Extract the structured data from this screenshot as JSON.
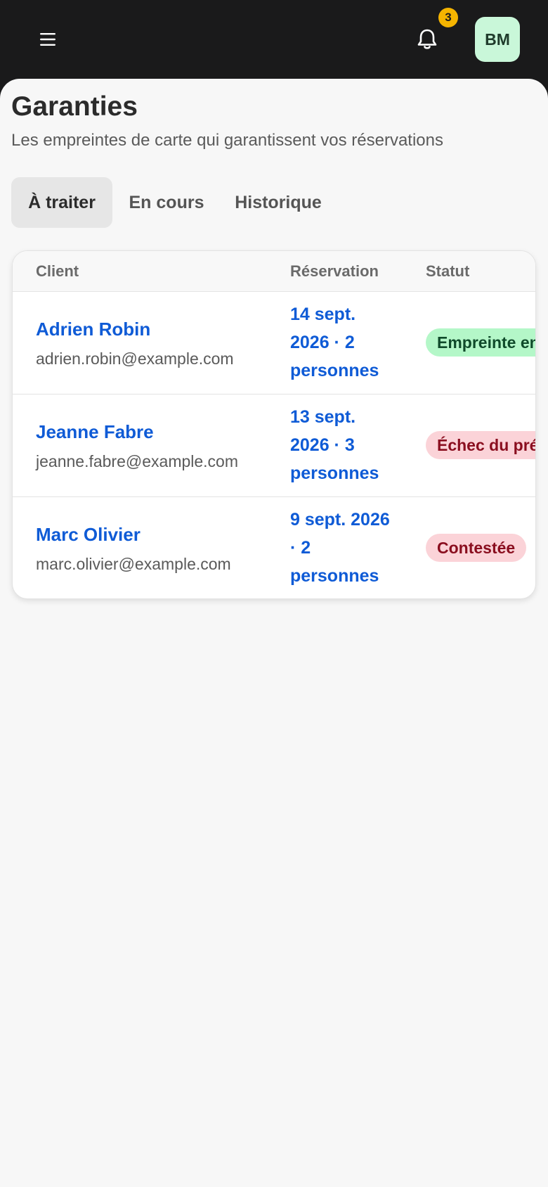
{
  "header": {
    "notifications_count": "3",
    "avatar_initials": "BM"
  },
  "page": {
    "title": "Garanties",
    "subtitle": "Les empreintes de carte qui garantissent vos réservations"
  },
  "tabs": [
    {
      "label": "À traiter",
      "active": true
    },
    {
      "label": "En cours",
      "active": false
    },
    {
      "label": "Historique",
      "active": false
    }
  ],
  "table": {
    "columns": [
      "Client",
      "Réservation",
      "Statut"
    ],
    "rows": [
      {
        "name": "Adrien Robin",
        "email": "adrien.robin@example.com",
        "reservation": "14 sept. 2026 · 2 personnes",
        "status": "Empreinte en",
        "status_tone": "green"
      },
      {
        "name": "Jeanne Fabre",
        "email": "jeanne.fabre@example.com",
        "reservation": "13 sept. 2026 · 3 personnes",
        "status": "Échec du prél",
        "status_tone": "red"
      },
      {
        "name": "Marc Olivier",
        "email": "marc.olivier@example.com",
        "reservation": "9 sept. 2026 · 2 personnes",
        "status": "Contestée",
        "status_tone": "red"
      }
    ]
  },
  "colors": {
    "topbar_bg": "#1a1a1b",
    "link_blue": "#0f5bd6",
    "badge_yellow": "#f5b400",
    "avatar_bg": "#c9f7d9"
  }
}
